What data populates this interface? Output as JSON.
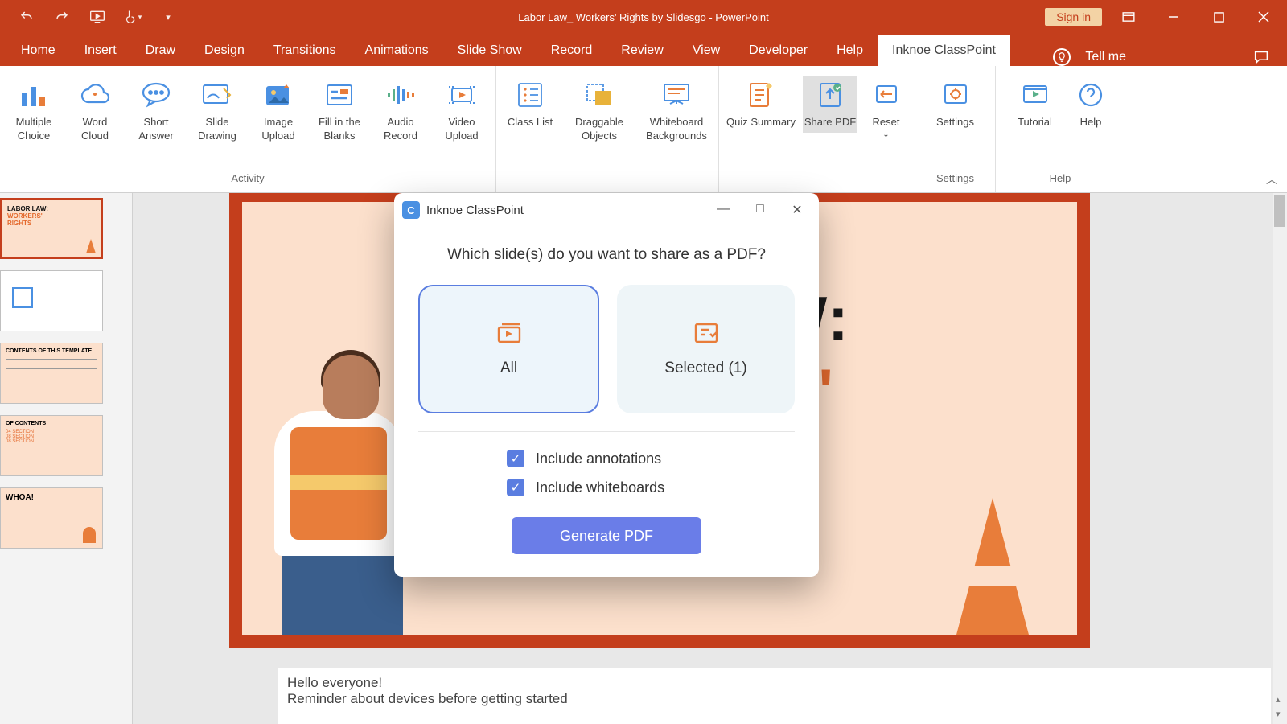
{
  "titlebar": {
    "title": "Labor Law_ Workers' Rights by Slidesgo  -  PowerPoint",
    "signin": "Sign in"
  },
  "tabs": {
    "items": [
      "Home",
      "Insert",
      "Draw",
      "Design",
      "Transitions",
      "Animations",
      "Slide Show",
      "Record",
      "Review",
      "View",
      "Developer",
      "Help",
      "Inknoe ClassPoint"
    ],
    "active": "Inknoe ClassPoint",
    "tellme": "Tell me"
  },
  "ribbon": {
    "activity": {
      "label": "Activity",
      "items": [
        "Multiple Choice",
        "Word Cloud",
        "Short Answer",
        "Slide Drawing",
        "Image Upload",
        "Fill in the Blanks",
        "Audio Record",
        "Video Upload"
      ]
    },
    "group2": {
      "items": [
        "Class List",
        "Draggable Objects",
        "Whiteboard Backgrounds"
      ]
    },
    "group3": {
      "items": [
        "Quiz Summary",
        "Share PDF",
        "Reset"
      ],
      "active": "Share PDF"
    },
    "settings": {
      "label": "Settings",
      "items": [
        "Settings"
      ]
    },
    "help": {
      "label": "Help",
      "items": [
        "Tutorial",
        "Help"
      ]
    }
  },
  "thumbs": {
    "t1a": "LABOR LAW:",
    "t1b": "WORKERS'",
    "t1c": "RIGHTS",
    "t3": "CONTENTS OF THIS TEMPLATE",
    "t4a": "OF CONTENTS",
    "t4b": "04 SECTION",
    "t4c": "08 SECTION",
    "t4d": "08 SECTION",
    "t5": "WHOA!"
  },
  "slide": {
    "line1": "LAW:",
    "line2": "ERS'"
  },
  "notes": {
    "line1": "Hello everyone!",
    "line2": "Reminder about devices before getting started"
  },
  "dialog": {
    "title": "Inknoe ClassPoint",
    "question": "Which slide(s) do you want to share as a PDF?",
    "opt_all": "All",
    "opt_selected": "Selected (1)",
    "chk1": "Include annotations",
    "chk2": "Include whiteboards",
    "button": "Generate PDF"
  }
}
